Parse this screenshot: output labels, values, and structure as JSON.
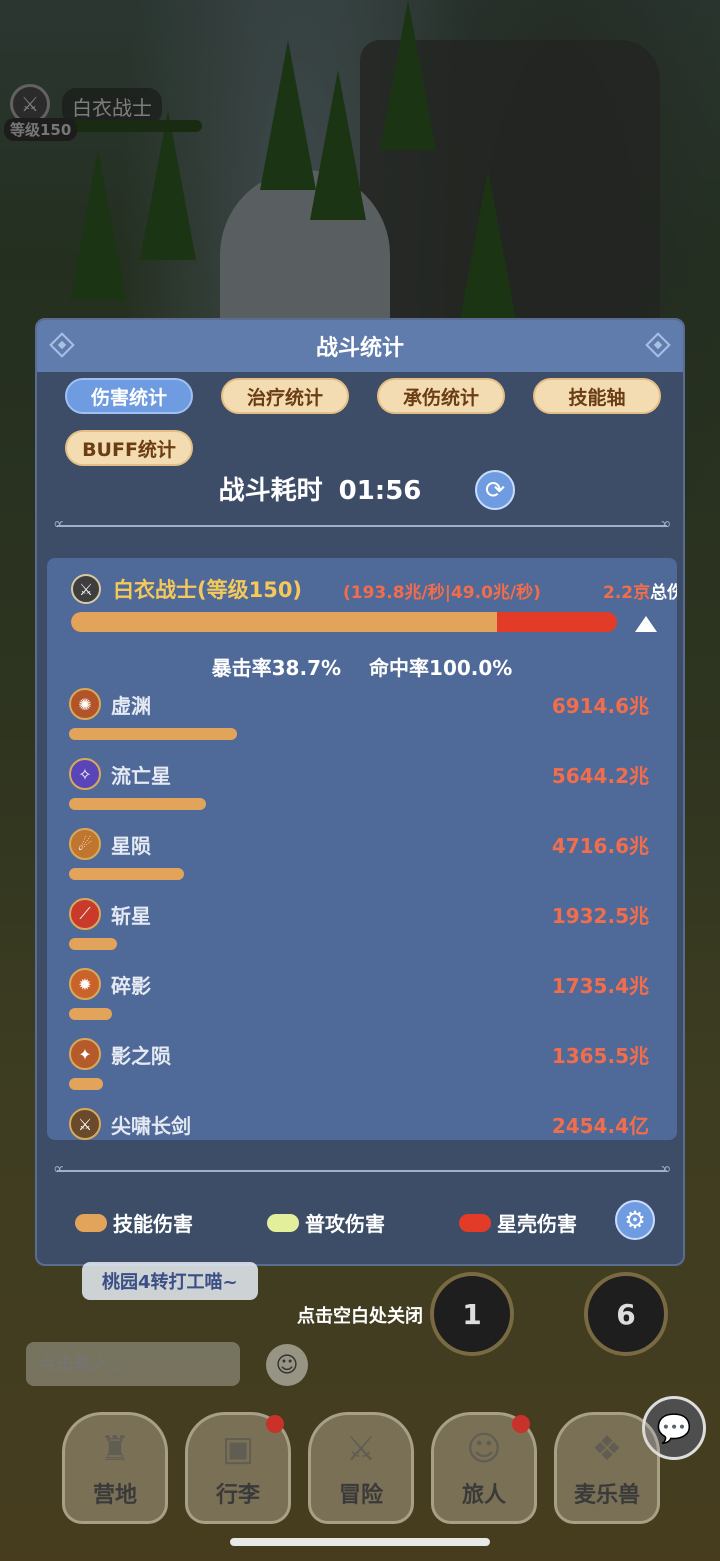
{
  "hud": {
    "player_name": "白衣战士",
    "level": "等级150"
  },
  "dialog": {
    "title": "战斗统计",
    "tabs": [
      {
        "label": "伤害统计",
        "active": true
      },
      {
        "label": "治疗统计",
        "active": false
      },
      {
        "label": "承伤统计",
        "active": false
      },
      {
        "label": "技能轴",
        "active": false
      },
      {
        "label": "BUFF统计",
        "active": false
      }
    ],
    "duration_label": "战斗耗时",
    "duration_value": "01:56",
    "player": {
      "name": "白衣战士(等级150)",
      "rates": "(193.8兆/秒|49.0兆/秒)",
      "total_value": "2.2京",
      "total_label": "总伤害",
      "skill_share": 0.78,
      "crit": "暴击率38.7%",
      "hit": "命中率100.0%"
    },
    "skills": [
      {
        "name": "虚渊",
        "value": "6914.6兆",
        "share": 0.3,
        "icon": "burst-icon",
        "color": "#b1542a"
      },
      {
        "name": "流亡星",
        "value": "5644.2兆",
        "share": 0.245,
        "icon": "star-icon",
        "color": "#5a45b8"
      },
      {
        "name": "星陨",
        "value": "4716.6兆",
        "share": 0.205,
        "icon": "meteor-icon",
        "color": "#c0762f"
      },
      {
        "name": "斩星",
        "value": "1932.5兆",
        "share": 0.085,
        "icon": "slash-icon",
        "color": "#c93a2a"
      },
      {
        "name": "碎影",
        "value": "1735.4兆",
        "share": 0.076,
        "icon": "shatter-icon",
        "color": "#c9632a"
      },
      {
        "name": "影之陨",
        "value": "1365.5兆",
        "share": 0.06,
        "icon": "fall-icon",
        "color": "#b55a2a"
      },
      {
        "name": "尖啸长剑",
        "value": "2454.4亿",
        "share": 0.0,
        "icon": "sword-icon",
        "color": "#6a4a2a"
      }
    ],
    "legend": [
      {
        "label": "技能伤害",
        "color": "#e2a45b"
      },
      {
        "label": "普攻伤害",
        "color": "#e3ef9a"
      },
      {
        "label": "星壳伤害",
        "color": "#e23b27"
      }
    ]
  },
  "chat": {
    "last_message": "桃园4转打工喵~",
    "input_placeholder": "点击输入..."
  },
  "close_hint": "点击空白处关闭",
  "skill_slots": [
    "1",
    "6"
  ],
  "nav": [
    {
      "label": "营地",
      "icon": "castle-icon",
      "badge": false
    },
    {
      "label": "行李",
      "icon": "chest-icon",
      "badge": true
    },
    {
      "label": "冒险",
      "icon": "swords-icon",
      "badge": false
    },
    {
      "label": "旅人",
      "icon": "hero-icon",
      "badge": true
    },
    {
      "label": "麦乐兽",
      "icon": "pet-icon",
      "badge": false
    }
  ]
}
